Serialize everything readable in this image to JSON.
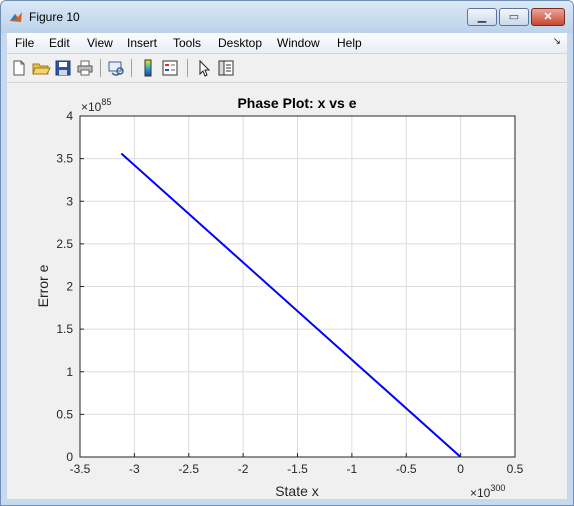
{
  "window": {
    "title": "Figure 10"
  },
  "menu": {
    "items": [
      "File",
      "Edit",
      "View",
      "Insert",
      "Tools",
      "Desktop",
      "Window",
      "Help"
    ]
  },
  "toolbar": {
    "icons": [
      "new-figure-icon",
      "open-file-icon",
      "save-icon",
      "print-icon",
      "link-plot-icon",
      "insert-colorbar-icon",
      "insert-legend-icon",
      "edit-plot-arrow-icon",
      "property-inspector-icon"
    ]
  },
  "colors": {
    "line": "#0000ff",
    "grid": "#dcdcdc",
    "figure_bg": "#f0f0f0",
    "title_bar": "#c7d9ee",
    "close_button": "#c8472f"
  },
  "chart_data": {
    "type": "line",
    "title": "Phase Plot: x vs e",
    "xlabel": "State x",
    "ylabel": "Error e",
    "x_multiplier": "×10",
    "x_multiplier_exp": "300",
    "y_multiplier": "×10",
    "y_multiplier_exp": "85",
    "xlim": [
      -3.5,
      0.5
    ],
    "ylim": [
      0,
      4
    ],
    "xticks": [
      "-3.5",
      "-3",
      "-2.5",
      "-2",
      "-1.5",
      "-1",
      "-0.5",
      "0",
      "0.5"
    ],
    "yticks": [
      "0",
      "0.5",
      "1",
      "1.5",
      "2",
      "2.5",
      "3",
      "3.5",
      "4"
    ],
    "grid": true,
    "series": [
      {
        "x": [
          -3.12,
          0
        ],
        "y": [
          3.56,
          0
        ]
      }
    ]
  }
}
